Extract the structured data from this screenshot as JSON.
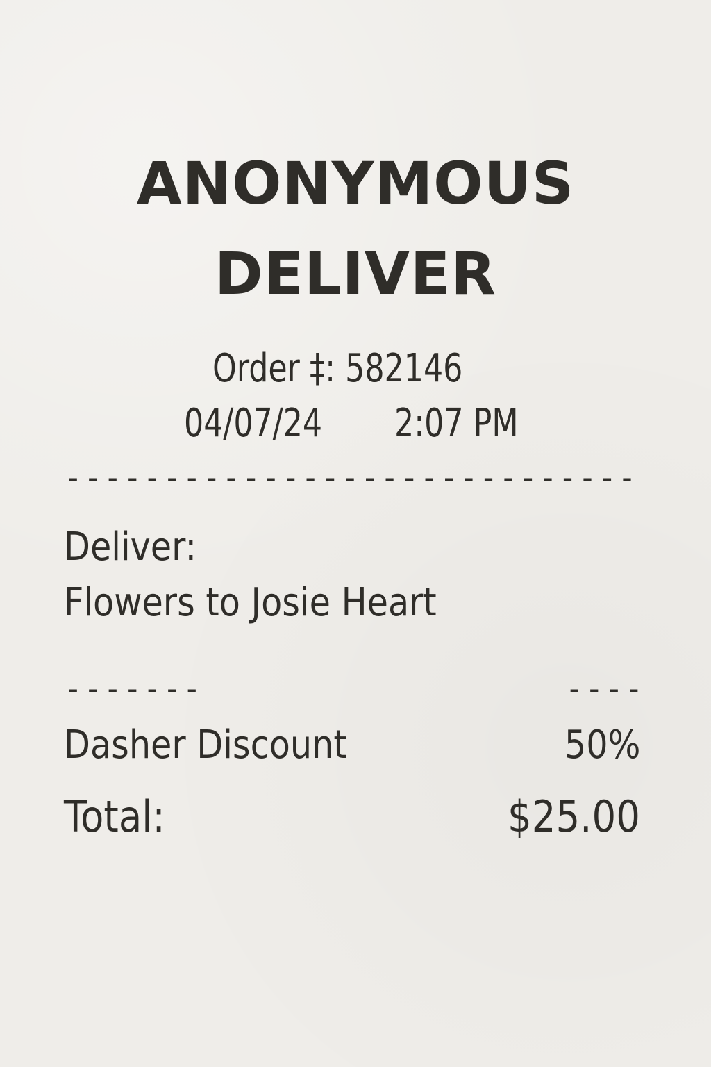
{
  "header": {
    "title_line_1": "ANONYMOUS",
    "title_line_2": "DELIVER"
  },
  "order": {
    "number_line": "Order ‡: 582146",
    "date": "04/07/24",
    "time": "2:07 PM"
  },
  "dividers": {
    "top": "------------------------------------",
    "left": "-------",
    "right": "----"
  },
  "delivery": {
    "label": "Deliver:",
    "item": "Flowers to Josie Heart"
  },
  "summary": {
    "discount_label": "Dasher Discount",
    "discount_value": "50%",
    "total_label": "Total:",
    "total_value": "$25.00"
  },
  "colors": {
    "paper": "#efede9",
    "ink": "#2f2d29"
  }
}
